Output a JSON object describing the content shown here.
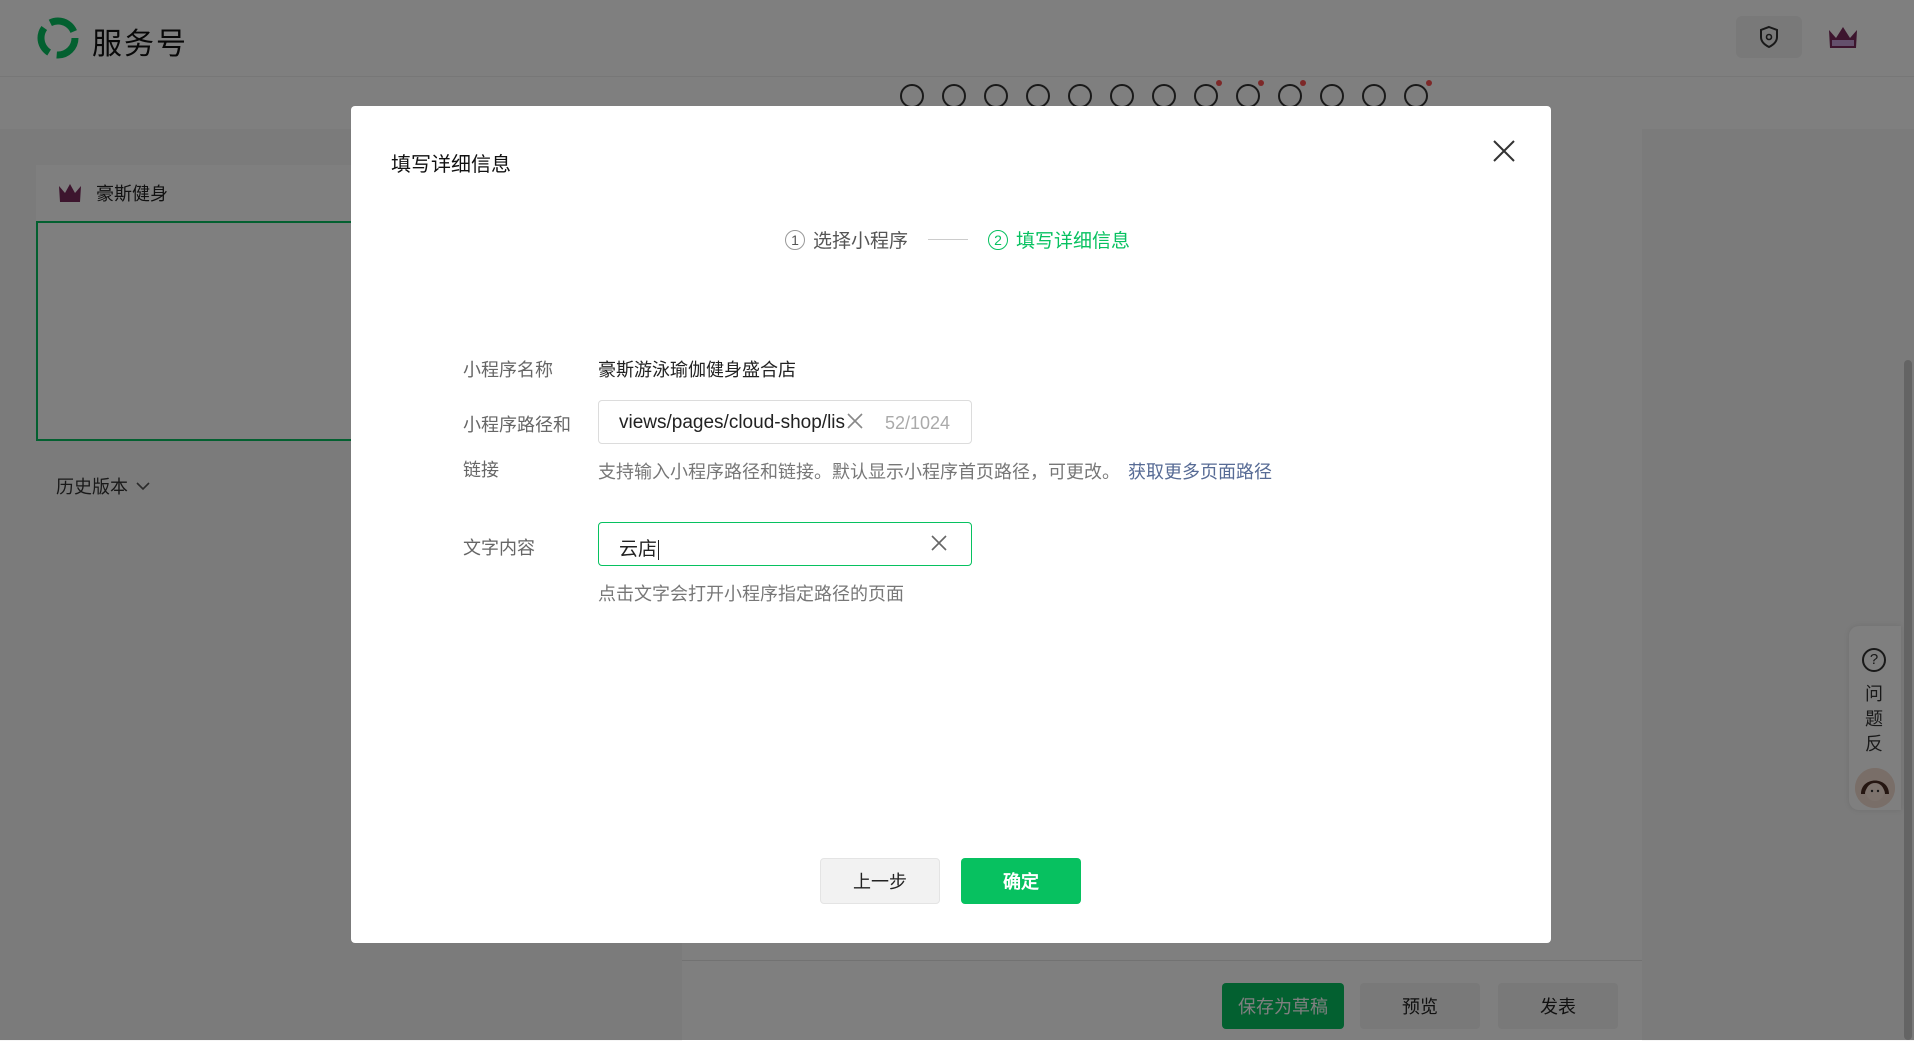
{
  "app": {
    "brand": "服务号"
  },
  "account": {
    "name": "豪斯健身"
  },
  "history": {
    "label": "历史版本"
  },
  "actions": {
    "save_draft": "保存为草稿",
    "preview": "预览",
    "publish": "发表"
  },
  "feedback": {
    "label": "问题反馈",
    "icon": "?"
  },
  "dialog": {
    "title": "填写详细信息",
    "steps": [
      {
        "num": "1",
        "label": "选择小程序"
      },
      {
        "num": "2",
        "label": "填写详细信息"
      }
    ],
    "name_label": "小程序名称",
    "name_value": "豪斯游泳瑜伽健身盛合店",
    "path_label_1": "小程序路径和",
    "path_label_2": "链接",
    "path_value": "views/pages/cloud-shop/lis",
    "path_count": "52/1024",
    "path_hint": "支持输入小程序路径和链接。默认显示小程序首页路径，可更改。",
    "path_hint_link": "获取更多页面路径",
    "text_label": "文字内容",
    "text_value": "云店",
    "text_hint": "点击文字会打开小程序指定路径的页面",
    "prev_button": "上一步",
    "ok_button": "确定"
  },
  "colors": {
    "primary": "#07c160",
    "link": "#576b95",
    "overlay": "rgba(0,0,0,0.5)"
  }
}
